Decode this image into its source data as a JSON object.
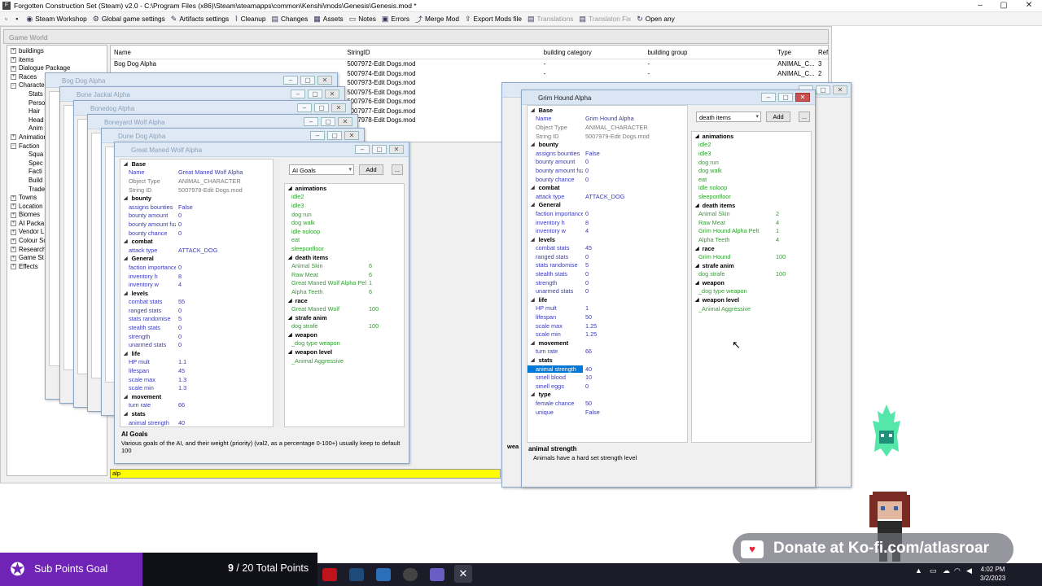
{
  "app": {
    "title": "Forgotten Construction Set (Steam) v2.0 - C:\\Program Files (x86)\\Steam\\steamapps\\common\\Kenshi\\mods\\Genesis\\Genesis.mod *",
    "icon": "app-icon"
  },
  "toolbar": {
    "items": [
      {
        "label": "Steam Workshop",
        "icon": "steam-icon"
      },
      {
        "label": "Global game settings",
        "icon": "gear-icon"
      },
      {
        "label": "Artifacts settings",
        "icon": "wrench-icon"
      },
      {
        "label": "Cleanup",
        "icon": "broom-icon"
      },
      {
        "label": "Changes",
        "icon": "changes-icon"
      },
      {
        "label": "Assets",
        "icon": "assets-icon"
      },
      {
        "label": "Notes",
        "icon": "notes-icon"
      },
      {
        "label": "Errors",
        "icon": "errors-icon"
      },
      {
        "label": "Merge Mod",
        "icon": "merge-icon"
      },
      {
        "label": "Export Mods file",
        "icon": "export-icon"
      },
      {
        "label": "Translations",
        "icon": "translations-icon",
        "disabled": true
      },
      {
        "label": "Translaton Fix",
        "icon": "fix-icon",
        "disabled": true
      },
      {
        "label": "Open any",
        "icon": "open-icon"
      }
    ]
  },
  "game_world": {
    "title": "Game World",
    "tree": [
      "buildings",
      "items",
      "Dialogue Package",
      "Races",
      "Characte",
      "Stats",
      "Perso",
      "Hair",
      "Head",
      "Anim",
      "Animation",
      "Faction",
      "Squa",
      "Spec",
      "Facti",
      "Build",
      "Trade",
      "Towns",
      "Location",
      "Biomes",
      "AI Packa",
      "Vendor L",
      "Colour Sc",
      "Research",
      "Game St",
      "Effects"
    ],
    "columns": [
      "Name",
      "StringID",
      "building category",
      "building group",
      "Type",
      "Ref"
    ],
    "rows": [
      [
        "Bog Dog Alpha",
        "5007972-Edit Dogs.mod",
        "-",
        "-",
        "ANIMAL_C...",
        "3"
      ],
      [
        "",
        "5007974-Edit Dogs.mod",
        "-",
        "-",
        "ANIMAL_C...",
        "2"
      ],
      [
        "",
        "5007973-Edit Dogs.mod",
        "-",
        "-",
        "",
        ""
      ],
      [
        "",
        "5007975-Edit Dogs.mod",
        "",
        "",
        "",
        ""
      ],
      [
        "",
        "5007976-Edit Dogs.mod",
        "",
        "",
        "",
        ""
      ],
      [
        "",
        "5007977-Edit Dogs.mod",
        "",
        "",
        "",
        ""
      ],
      [
        "",
        "5007978-Edit Dogs.mod",
        "",
        "",
        "",
        ""
      ]
    ],
    "filter": "alp"
  },
  "stacked_windows": [
    "Bog Dog Alpha",
    "Bone Jackal Alpha",
    "Bonedog Alpha",
    "Boneyard Wolf Alpha",
    "Dune Dog Alpha"
  ],
  "wolf": {
    "title": "Great Maned Wolf Alpha",
    "combo": "AI Goals",
    "add": "Add",
    "more": "...",
    "sections": [
      {
        "name": "Base",
        "rows": [
          [
            "Name",
            "Great Maned Wolf Alpha"
          ],
          [
            "Object Type",
            "ANIMAL_CHARACTER"
          ],
          [
            "String ID",
            "5007978-Edit Dogs.mod"
          ]
        ]
      },
      {
        "name": "bounty",
        "rows": [
          [
            "assigns bounties",
            "False"
          ],
          [
            "bounty amount",
            "0"
          ],
          [
            "bounty amount fuzz",
            "0"
          ],
          [
            "bounty chance",
            "0"
          ]
        ]
      },
      {
        "name": "combat",
        "rows": [
          [
            "attack type",
            "ATTACK_DOG"
          ]
        ]
      },
      {
        "name": "General",
        "rows": [
          [
            "faction importance",
            "0"
          ],
          [
            "inventory h",
            "8"
          ],
          [
            "inventory w",
            "4"
          ]
        ]
      },
      {
        "name": "levels",
        "rows": [
          [
            "combat stats",
            "55"
          ],
          [
            "ranged stats",
            "0"
          ],
          [
            "stats randomise",
            "5"
          ],
          [
            "stealth stats",
            "0"
          ],
          [
            "strength",
            "0"
          ],
          [
            "unarmed stats",
            "0"
          ]
        ]
      },
      {
        "name": "life",
        "rows": [
          [
            "HP mult",
            "1.1"
          ],
          [
            "lifespan",
            "45"
          ],
          [
            "scale max",
            "1.3"
          ],
          [
            "scale min",
            "1.3"
          ]
        ]
      },
      {
        "name": "movement",
        "rows": [
          [
            "turn rate",
            "66"
          ]
        ]
      },
      {
        "name": "stats",
        "rows": [
          [
            "animal strength",
            "40"
          ]
        ]
      }
    ],
    "right": [
      {
        "name": "animations",
        "rows": [
          [
            "idle2",
            ""
          ],
          [
            "idle3",
            ""
          ],
          [
            "dog run",
            ""
          ],
          [
            "dog walk",
            ""
          ],
          [
            "idle noloop",
            ""
          ],
          [
            "eat",
            ""
          ],
          [
            "sleeponfloor",
            ""
          ]
        ]
      },
      {
        "name": "death items",
        "rows": [
          [
            "Animal Skin",
            "6"
          ],
          [
            "Raw Meat",
            "6"
          ],
          [
            "Great Maned Wolf Alpha Pelt",
            "1"
          ],
          [
            "Alpha Teeth",
            "6"
          ]
        ]
      },
      {
        "name": "race",
        "rows": [
          [
            "Great Maned Wolf",
            "100"
          ]
        ]
      },
      {
        "name": "strafe anim",
        "rows": [
          [
            "dog strafe",
            "100"
          ]
        ]
      },
      {
        "name": "weapon",
        "rows": [
          [
            "_dog type weapon",
            ""
          ]
        ]
      },
      {
        "name": "weapon level",
        "rows": [
          [
            "_Animal Aggressive",
            ""
          ]
        ]
      }
    ],
    "desc_title": "AI Goals",
    "desc_text": "Various goals of the AI, and their weight (priority) (val2, as a percentage 0-100+) usually keep to default 100"
  },
  "hound": {
    "title": "Grim Hound Alpha",
    "combo": "death items",
    "add": "Add",
    "more": "...",
    "sections": [
      {
        "name": "Base",
        "rows": [
          [
            "Name",
            "Grim Hound Alpha"
          ],
          [
            "Object Type",
            "ANIMAL_CHARACTER"
          ],
          [
            "String ID",
            "5007979-Edit Dogs.mod"
          ]
        ]
      },
      {
        "name": "bounty",
        "rows": [
          [
            "assigns bounties",
            "False"
          ],
          [
            "bounty amount",
            "0"
          ],
          [
            "bounty amount fuzz",
            "0"
          ],
          [
            "bounty chance",
            "0"
          ]
        ]
      },
      {
        "name": "combat",
        "rows": [
          [
            "attack type",
            "ATTACK_DOG"
          ]
        ]
      },
      {
        "name": "General",
        "rows": [
          [
            "faction importance",
            "0"
          ],
          [
            "inventory h",
            "8"
          ],
          [
            "inventory w",
            "4"
          ]
        ]
      },
      {
        "name": "levels",
        "rows": [
          [
            "combat stats",
            "45"
          ],
          [
            "ranged stats",
            "0"
          ],
          [
            "stats randomise",
            "5"
          ],
          [
            "stealth stats",
            "0"
          ],
          [
            "strength",
            "0"
          ],
          [
            "unarmed stats",
            "0"
          ]
        ]
      },
      {
        "name": "life",
        "rows": [
          [
            "HP mult",
            "1"
          ],
          [
            "lifespan",
            "50"
          ],
          [
            "scale max",
            "1.25"
          ],
          [
            "scale min",
            "1.25"
          ]
        ]
      },
      {
        "name": "movement",
        "rows": [
          [
            "turn rate",
            "66"
          ]
        ]
      },
      {
        "name": "stats",
        "rows": [
          [
            "animal strength",
            "40"
          ],
          [
            "smell blood",
            "10"
          ],
          [
            "smell eggs",
            "0"
          ]
        ]
      },
      {
        "name": "type",
        "rows": [
          [
            "female chance",
            "50"
          ],
          [
            "unique",
            "False"
          ]
        ]
      }
    ],
    "right": [
      {
        "name": "animations",
        "rows": [
          [
            "idle2",
            ""
          ],
          [
            "idle3",
            ""
          ],
          [
            "dog run",
            ""
          ],
          [
            "dog walk",
            ""
          ],
          [
            "eat",
            ""
          ],
          [
            "idle noloop",
            ""
          ],
          [
            "sleeponfloor",
            ""
          ]
        ]
      },
      {
        "name": "death items",
        "rows": [
          [
            "Animal Skin",
            "2"
          ],
          [
            "Raw Meat",
            "4"
          ],
          [
            "Grim Hound Alpha Pelt",
            "1"
          ],
          [
            "Alpha Teeth",
            "4"
          ]
        ]
      },
      {
        "name": "race",
        "rows": [
          [
            "Grim Hound",
            "100"
          ]
        ]
      },
      {
        "name": "strafe anim",
        "rows": [
          [
            "dog strafe",
            "100"
          ]
        ]
      },
      {
        "name": "weapon",
        "rows": [
          [
            "_dog type weapon",
            ""
          ]
        ]
      },
      {
        "name": "weapon level",
        "rows": [
          [
            "_Animal Aggressive",
            ""
          ]
        ]
      }
    ],
    "desc_title": "animal strength",
    "desc_text": "Animals have a hard set strength level"
  },
  "overlay": {
    "sub_goal": "Sub Points Goal",
    "points_current": "9",
    "points_rest": " / 20 Total Points",
    "donate": "Donate at Ko-fi.com/atlasroar"
  },
  "taskbar": {
    "time": "4:02 PM",
    "date": "3/2/2023"
  },
  "colors": {
    "accent": "#0078d7",
    "filter": "#ffff00",
    "subgoal": "#6f24b5"
  }
}
